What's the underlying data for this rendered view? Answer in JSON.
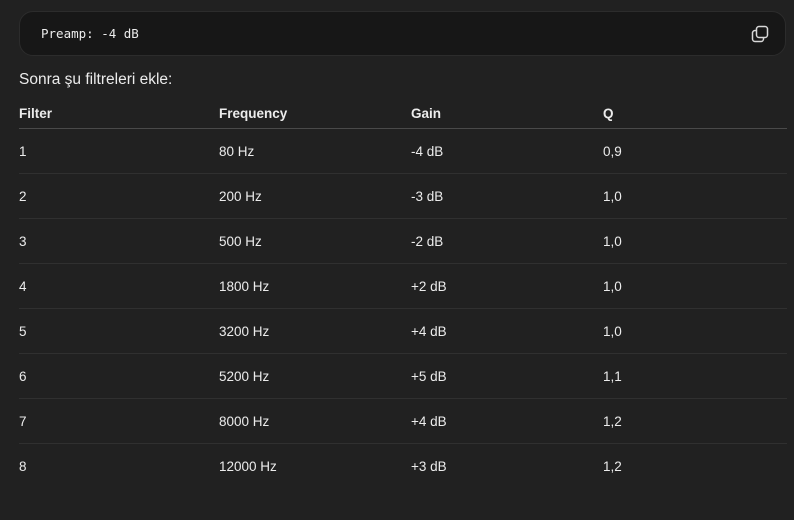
{
  "code_block": {
    "text": "Preamp: -4 dB",
    "copy_icon": "copy-icon"
  },
  "intro_text": "Sonra şu filtreleri ekle:",
  "table": {
    "headers": [
      "Filter",
      "Frequency",
      "Gain",
      "Q"
    ],
    "rows": [
      [
        "1",
        "80 Hz",
        "-4 dB",
        "0,9"
      ],
      [
        "2",
        "200 Hz",
        "-3 dB",
        "1,0"
      ],
      [
        "3",
        "500 Hz",
        "-2 dB",
        "1,0"
      ],
      [
        "4",
        "1800 Hz",
        "+2 dB",
        "1,0"
      ],
      [
        "5",
        "3200 Hz",
        "+4 dB",
        "1,0"
      ],
      [
        "6",
        "5200 Hz",
        "+5 dB",
        "1,1"
      ],
      [
        "7",
        "8000 Hz",
        "+4 dB",
        "1,2"
      ],
      [
        "8",
        "12000 Hz",
        "+3 dB",
        "1,2"
      ]
    ]
  },
  "colors": {
    "background": "#212121",
    "code_background": "#171717",
    "text": "#ececec"
  }
}
